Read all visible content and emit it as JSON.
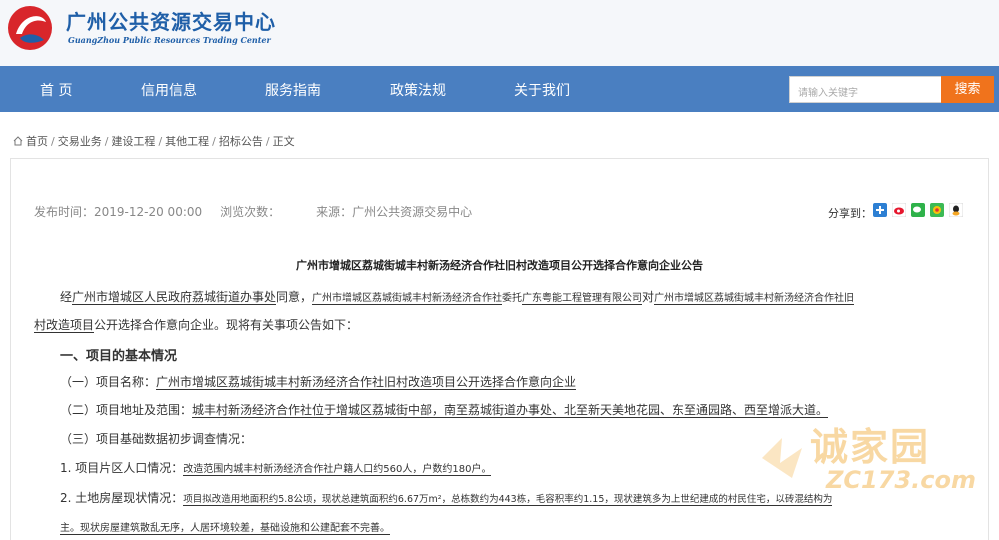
{
  "header": {
    "title": "广州公共资源交易中心",
    "subtitle": "GuangZhou Public Resources Trading Center"
  },
  "nav": {
    "items": [
      {
        "label": "首 页"
      },
      {
        "label": "信用信息"
      },
      {
        "label": "服务指南"
      },
      {
        "label": "政策法规"
      },
      {
        "label": "关于我们"
      }
    ],
    "search_placeholder": "请输入关键字",
    "search_button": "搜索"
  },
  "breadcrumb": [
    "首页",
    "交易业务",
    "建设工程",
    "其他工程",
    "招标公告",
    "正文"
  ],
  "meta": {
    "publish_time": "发布时间：2019-12-20 00:00",
    "views": "浏览次数：",
    "source": "来源：广州公共资源交易中心",
    "share_label": "分享到："
  },
  "share_icons": [
    "qzone-icon",
    "weibo-icon",
    "wechat-icon",
    "moments-icon",
    "qq-icon"
  ],
  "colors": {
    "nav": "#4a7fc1",
    "brand": "#1f5fa8",
    "search_button": "#f0731c"
  },
  "article": {
    "title": "广州市增城区荔城街城丰村新汤经济合作社旧村改造项目公开选择合作意向企业公告",
    "p1a": "经",
    "p1b": "广州市增城区人民政府荔城街道办事处",
    "p1c": "同意，",
    "p1d": "广州市增城区荔城街城丰村新汤经济合作社",
    "p1e": "委托",
    "p1f": "广东粤能工程管理有限公司",
    "p1g": "对",
    "p1h": "广州市增城区荔城街城丰村新汤经济合作社旧",
    "p2a": "村改造项目",
    "p2b": "公开选择合作意向企业。现将有关事项公告如下：",
    "h1": "一、项目的基本情况",
    "item1a": "（一）项目名称：",
    "item1b": "广州市增城区荔城街城丰村新汤经济合作社旧村改造项目公开选择合作意向企业",
    "item2a": "（二）项目地址及范围：",
    "item2b": "城丰村新汤经济合作社位于增城区荔城街中部，南至荔城街道办事处、北至新天美地花园、东至通园路、西至增派大道。",
    "item3": "（三）项目基础数据初步调查情况：",
    "d1a": "1. 项目片区人口情况：",
    "d1b": "改造范围内城丰村新汤经济合作社户籍人口约560人，户数约180户。",
    "d2a": "2. 土地房屋现状情况：",
    "d2b": "项目拟改造用地面积约5.8公顷，现状总建筑面积约6.67万m²，总栋数约为443栋，毛容积率约1.15，现状建筑多为上世纪建成的村民住宅，以砖混结构为",
    "d3": "主。现状房屋建筑散乱无序，人居环境较差，基础设施和公建配套不完善。"
  },
  "watermark": {
    "text": "诚家园",
    "url": "ZC173.com"
  }
}
